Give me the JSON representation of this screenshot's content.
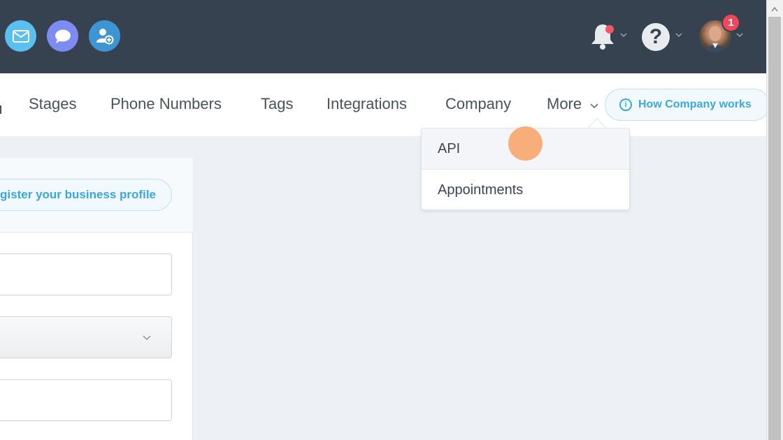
{
  "topbar": {
    "icons": [
      "mail-icon",
      "chat-icon",
      "add-user-icon",
      "bell-icon",
      "help-icon"
    ],
    "help_glyph": "?",
    "notification_badge": "1",
    "colors": {
      "background": "#36424f",
      "mail": "#5bc0f0",
      "chat": "#7c8cf2",
      "add_user": "#3d95d4",
      "badge": "#f0475a"
    }
  },
  "tabs": [
    {
      "label": "Stages"
    },
    {
      "label": "Phone Numbers"
    },
    {
      "label": "Tags"
    },
    {
      "label": "Integrations"
    },
    {
      "label": "Company"
    },
    {
      "label": "More"
    }
  ],
  "how_button": {
    "label": "How Company works",
    "icon": "info-icon"
  },
  "more_menu": {
    "items": [
      {
        "label": "API",
        "hovered": true
      },
      {
        "label": "Appointments",
        "hovered": false
      }
    ]
  },
  "card": {
    "register_button": "egister your business profile"
  },
  "accent_color": "#3aa8de"
}
